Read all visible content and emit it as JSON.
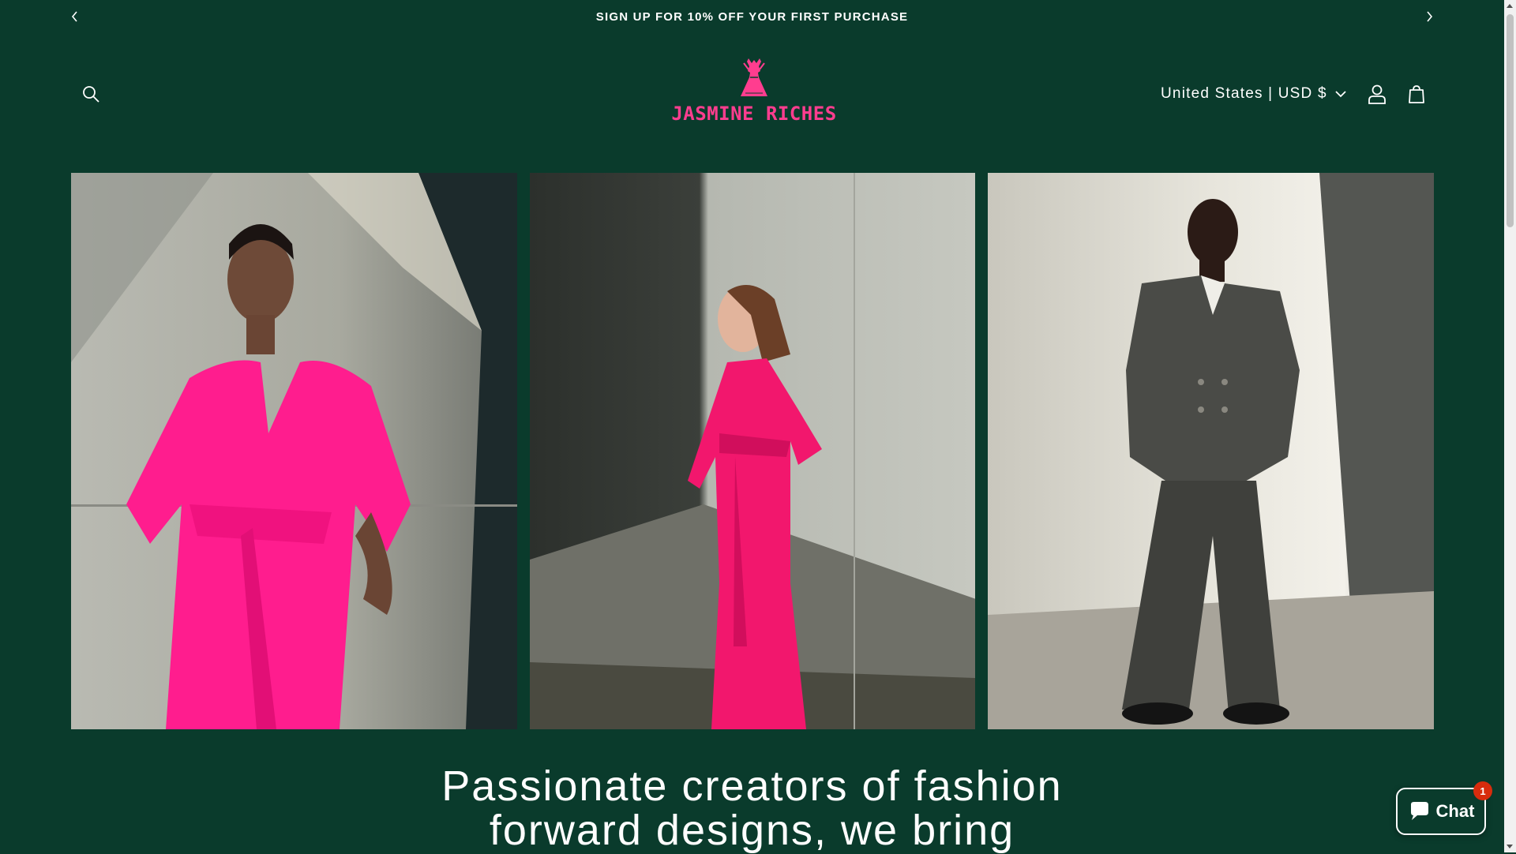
{
  "announcement": {
    "text": "SIGN UP FOR 10% OFF YOUR FIRST PURCHASE",
    "prev_icon": "chevron-left-icon",
    "next_icon": "chevron-right-icon"
  },
  "header": {
    "logo_text": "JASMINE RICHES",
    "locale_label": "United States | USD $",
    "icons": [
      "search-icon",
      "account-icon",
      "cart-icon"
    ]
  },
  "gallery": {
    "images": [
      {
        "subject": "model in pink wrap dress"
      },
      {
        "subject": "model in pink shirt dress walking"
      },
      {
        "subject": "model in dark grey suit"
      }
    ]
  },
  "main": {
    "headline_line1": "Passionate creators of fashion",
    "headline_line2": "forward designs, we bring"
  },
  "chat": {
    "label": "Chat",
    "badge_count": "1"
  },
  "colors": {
    "background": "#0a3b2c",
    "brand_pink": "#ff3d8f",
    "text": "#ffffff"
  }
}
